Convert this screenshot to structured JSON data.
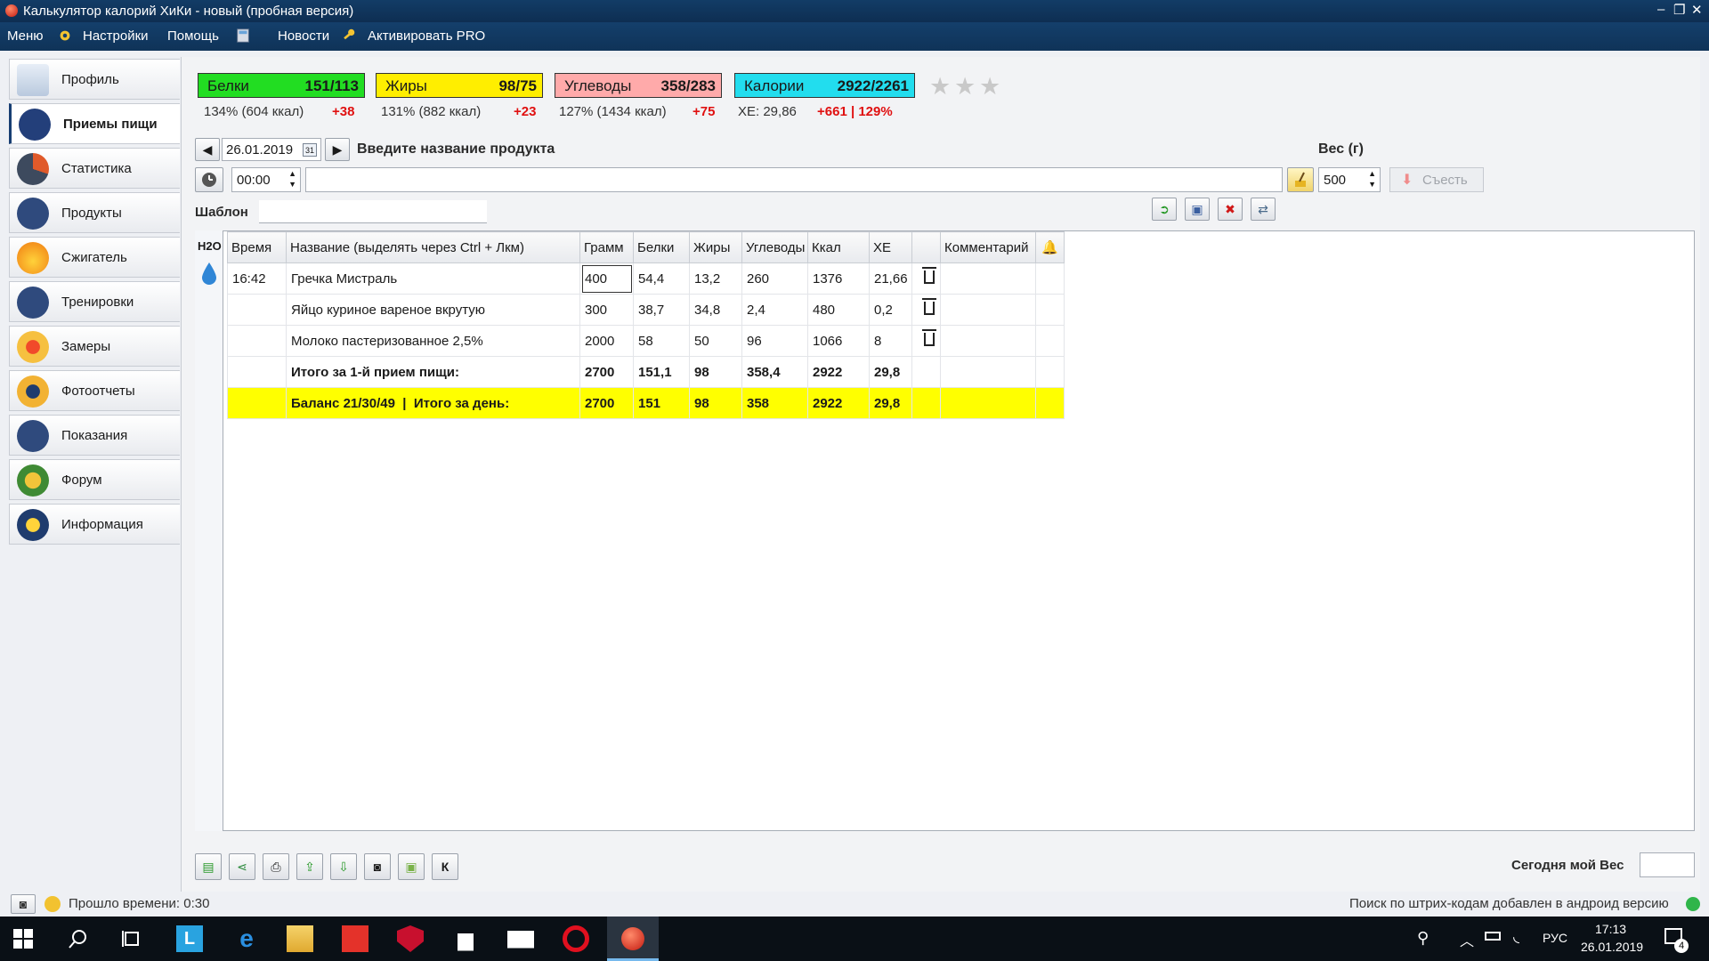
{
  "window": {
    "title": "Калькулятор калорий ХиКи - новый (пробная версия)"
  },
  "menubar": {
    "menu": "Меню",
    "settings": "Настройки",
    "help": "Помощь",
    "news": "Новости",
    "activate": "Активировать PRO"
  },
  "sidebar": {
    "items": [
      {
        "label": "Профиль"
      },
      {
        "label": "Приемы пищи"
      },
      {
        "label": "Статистика"
      },
      {
        "label": "Продукты"
      },
      {
        "label": "Сжигатель"
      },
      {
        "label": "Тренировки"
      },
      {
        "label": "Замеры"
      },
      {
        "label": "Фотоотчеты"
      },
      {
        "label": "Показания"
      },
      {
        "label": "Форум"
      },
      {
        "label": "Информация"
      }
    ]
  },
  "macros": {
    "protein": {
      "name": "Белки",
      "value": "151/113",
      "pct": "134% (604 ккал)",
      "diff": "+38",
      "color": "#22dd22"
    },
    "fat": {
      "name": "Жиры",
      "value": "98/75",
      "pct": "131% (882 ккал)",
      "diff": "+23",
      "color": "#ffee00"
    },
    "carbs": {
      "name": "Углеводы",
      "value": "358/283",
      "pct": "127% (1434 ккал)",
      "diff": "+75",
      "color": "#ffaaaa"
    },
    "calories": {
      "name": "Калории",
      "value": "2922/2261",
      "xe": "ХЕ: 29,86",
      "diff": "+661 | 129%",
      "color": "#22ddee"
    }
  },
  "entry": {
    "date": "26.01.2019",
    "calendar_day": "31",
    "prompt": "Введите название продукта",
    "time": "00:00",
    "product_value": "",
    "weight_label": "Вес (г)",
    "weight": "500",
    "eat_label": "Съесть",
    "template_label": "Шаблон",
    "template_value": ""
  },
  "table": {
    "h2o": "H2O",
    "columns": [
      "Время",
      "Название (выделять через Ctrl + Лкм)",
      "Грамм",
      "Белки",
      "Жиры",
      "Углеводы",
      "Ккал",
      "ХЕ",
      "",
      "Комментарий",
      ""
    ],
    "rows": [
      {
        "time": "16:42",
        "name": "Гречка Мистраль",
        "grams": "400",
        "protein": "54,4",
        "fat": "13,2",
        "carbs": "260",
        "kcal": "1376",
        "xe": "21,66"
      },
      {
        "time": "",
        "name": "Яйцо куриное вареное вкрутую",
        "grams": "300",
        "protein": "38,7",
        "fat": "34,8",
        "carbs": "2,4",
        "kcal": "480",
        "xe": "0,2"
      },
      {
        "time": "",
        "name": "Молоко пастеризованное 2,5%",
        "grams": "2000",
        "protein": "58",
        "fat": "50",
        "carbs": "96",
        "kcal": "1066",
        "xe": "8"
      }
    ],
    "meal_total": {
      "label": "Итого за 1-й прием пищи:",
      "grams": "2700",
      "protein": "151,1",
      "fat": "98",
      "carbs": "358,4",
      "kcal": "2922",
      "xe": "29,8"
    },
    "day_total": {
      "label": "Баланс 21/30/49  |  Итого за день:",
      "grams": "2700",
      "protein": "151",
      "fat": "98",
      "carbs": "358",
      "kcal": "2922",
      "xe": "29,8"
    }
  },
  "bottom": {
    "k_label": "К",
    "weight_today_label": "Сегодня мой Вес",
    "weight_today_value": ""
  },
  "status": {
    "elapsed": "Прошло времени: 0:30",
    "message": "Поиск по штрих-кодам добавлен в андроид версию"
  },
  "taskbar": {
    "lang": "РУС",
    "time": "17:13",
    "date": "26.01.2019",
    "notifications": "4"
  }
}
